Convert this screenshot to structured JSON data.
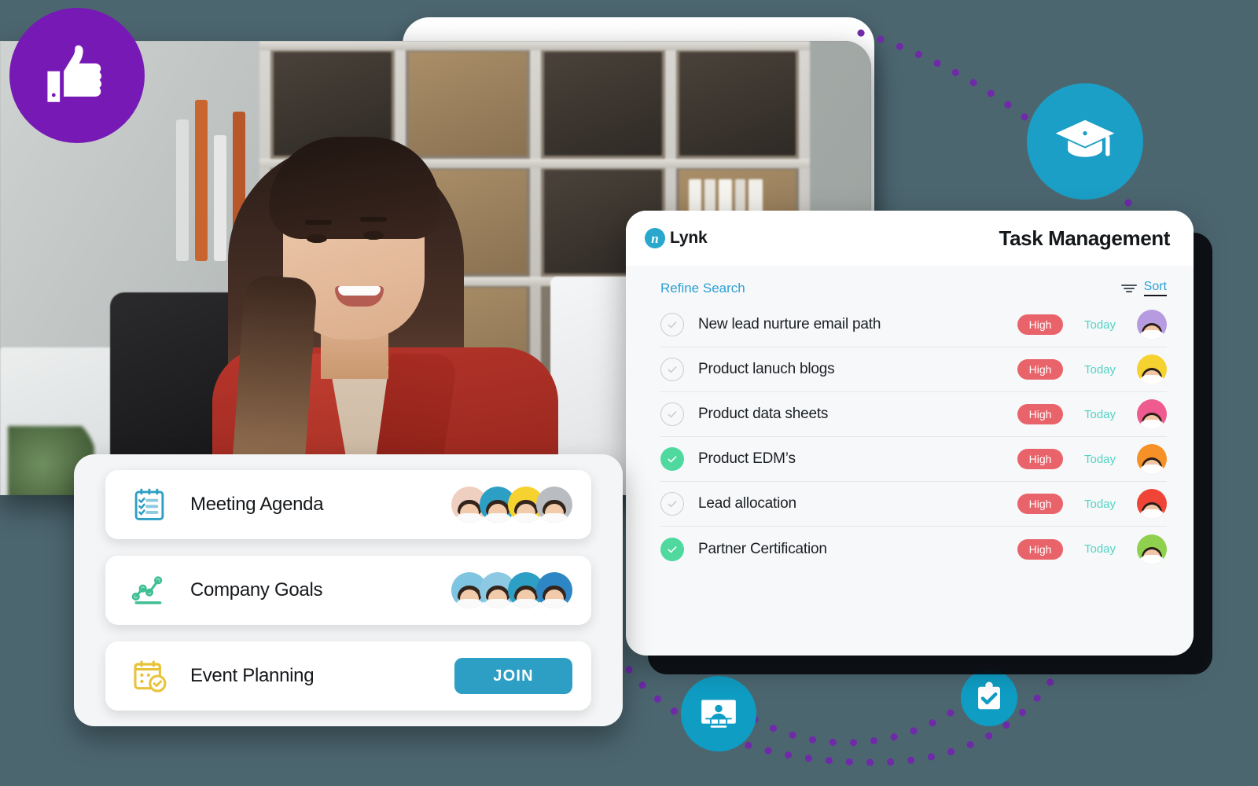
{
  "background_color": "#4c6670",
  "badges": [
    {
      "name": "thumbs-up",
      "color": "#7719b5",
      "label": "Thumbs Up"
    },
    {
      "name": "graduation-cap",
      "color": "#1b9fc6",
      "label": "Graduation Cap"
    },
    {
      "name": "presentation",
      "color": "#0f9dc4",
      "label": "Webinar Presentation"
    },
    {
      "name": "clipboard-check",
      "color": "#0f9dc4",
      "label": "Clipboard Check"
    }
  ],
  "dot_path_color": "#6f2aa8",
  "task_panel": {
    "brand": {
      "mark": "n",
      "name": "Lynk"
    },
    "title": "Task Management",
    "toolbar": {
      "refine_label": "Refine Search",
      "sort_label": "Sort"
    },
    "accent_link": "#2e9fd4",
    "priority_color": "#e9636a",
    "due_color": "#53d3c5",
    "done_color": "#4fd99f",
    "rows": [
      {
        "name": "New lead nurture email path",
        "priority": "High",
        "due": "Today",
        "done": false,
        "avatar_color": "#b79be0"
      },
      {
        "name": "Product lanuch blogs",
        "priority": "High",
        "due": "Today",
        "done": false,
        "avatar_color": "#f6d230"
      },
      {
        "name": "Product data sheets",
        "priority": "High",
        "due": "Today",
        "done": false,
        "avatar_color": "#ef5b8e"
      },
      {
        "name": "Product EDM’s",
        "priority": "High",
        "due": "Today",
        "done": true,
        "avatar_color": "#f59127"
      },
      {
        "name": "Lead allocation",
        "priority": "High",
        "due": "Today",
        "done": false,
        "avatar_color": "#f04437"
      },
      {
        "name": "Partner Certification",
        "priority": "High",
        "due": "Today",
        "done": true,
        "avatar_color": "#8fd14f"
      }
    ]
  },
  "cards_panel": {
    "cards": [
      {
        "label": "Meeting Agenda",
        "icon": "checklist-notepad-icon",
        "icon_color": "#2e9fc4",
        "action": "avatars",
        "avatars": [
          "#efcfc0",
          "#2e9fc4",
          "#f6d230",
          "#b9bdc2"
        ]
      },
      {
        "label": "Company Goals",
        "icon": "line-chart-icon",
        "icon_color": "#3fbf94",
        "action": "avatars",
        "avatars": [
          "#7fc4e0",
          "#8ec9e4",
          "#2e9fc4",
          "#2f86c4"
        ]
      },
      {
        "label": "Event Planning",
        "icon": "calendar-check-icon",
        "icon_color": "#e8c33a",
        "action": "button",
        "button_label": "JOIN"
      }
    ]
  }
}
